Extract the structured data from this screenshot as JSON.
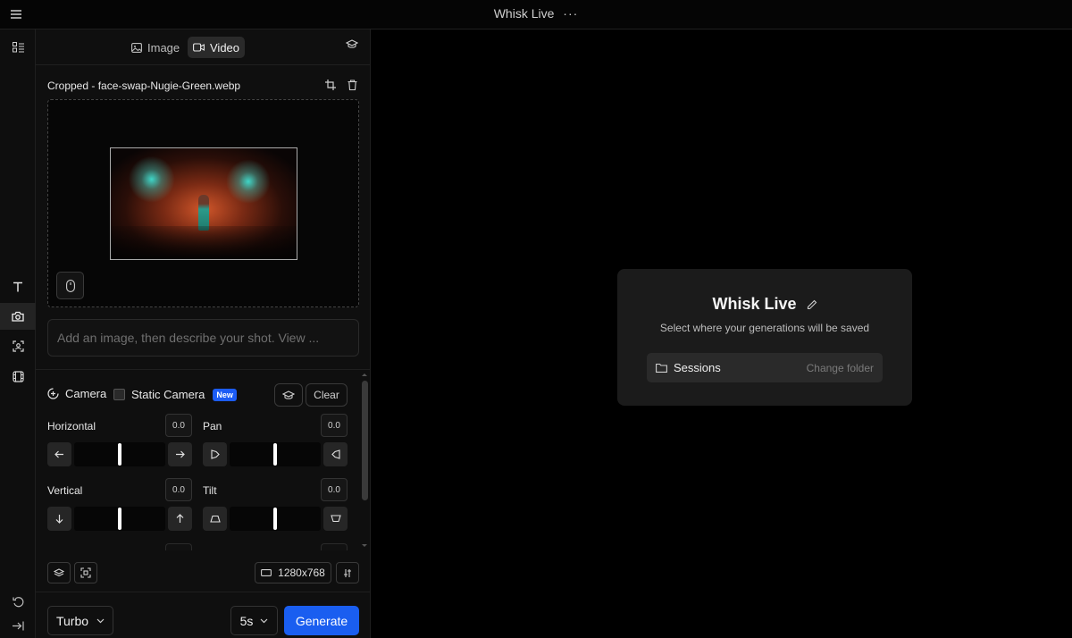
{
  "header": {
    "title": "Whisk Live",
    "more_label": "···"
  },
  "mode_tabs": [
    {
      "label": "Image",
      "icon": "image-icon",
      "active": false
    },
    {
      "label": "Video",
      "icon": "video-icon",
      "active": true
    }
  ],
  "rail": {
    "items": [
      {
        "icon": "text-icon",
        "active": false
      },
      {
        "icon": "camera-icon",
        "active": true
      },
      {
        "icon": "face-scan-icon",
        "active": false
      },
      {
        "icon": "film-icon",
        "active": false
      }
    ]
  },
  "file": {
    "name": "Cropped - face-swap-Nugie-Green.webp"
  },
  "prompt": {
    "placeholder": "Add an image, then describe your shot. View ..."
  },
  "camera": {
    "label": "Camera",
    "static_label": "Static Camera",
    "static_checked": false,
    "new_badge": "New",
    "clear_label": "Clear",
    "controls": [
      {
        "label": "Horizontal",
        "value": "0.0",
        "position": 0.5,
        "left_icon": "arrow-left-icon",
        "right_icon": "arrow-right-icon"
      },
      {
        "label": "Pan",
        "value": "0.0",
        "position": 0.5,
        "left_icon": "pan-left-icon",
        "right_icon": "pan-right-icon"
      },
      {
        "label": "Vertical",
        "value": "0.0",
        "position": 0.5,
        "left_icon": "arrow-down-icon",
        "right_icon": "arrow-up-icon"
      },
      {
        "label": "Tilt",
        "value": "0.0",
        "position": 0.5,
        "left_icon": "tilt-up-icon",
        "right_icon": "tilt-down-icon"
      }
    ]
  },
  "tools": {
    "resolution": "1280x768"
  },
  "generate_bar": {
    "model": "Turbo",
    "duration": "5s",
    "generate_label": "Generate"
  },
  "dialog": {
    "title": "Whisk Live",
    "subtitle": "Select where your generations will be saved",
    "folder": "Sessions",
    "change_label": "Change folder"
  },
  "colors": {
    "accent": "#1a5ef0",
    "badge": "#1c5cf5",
    "background": "#000000"
  }
}
